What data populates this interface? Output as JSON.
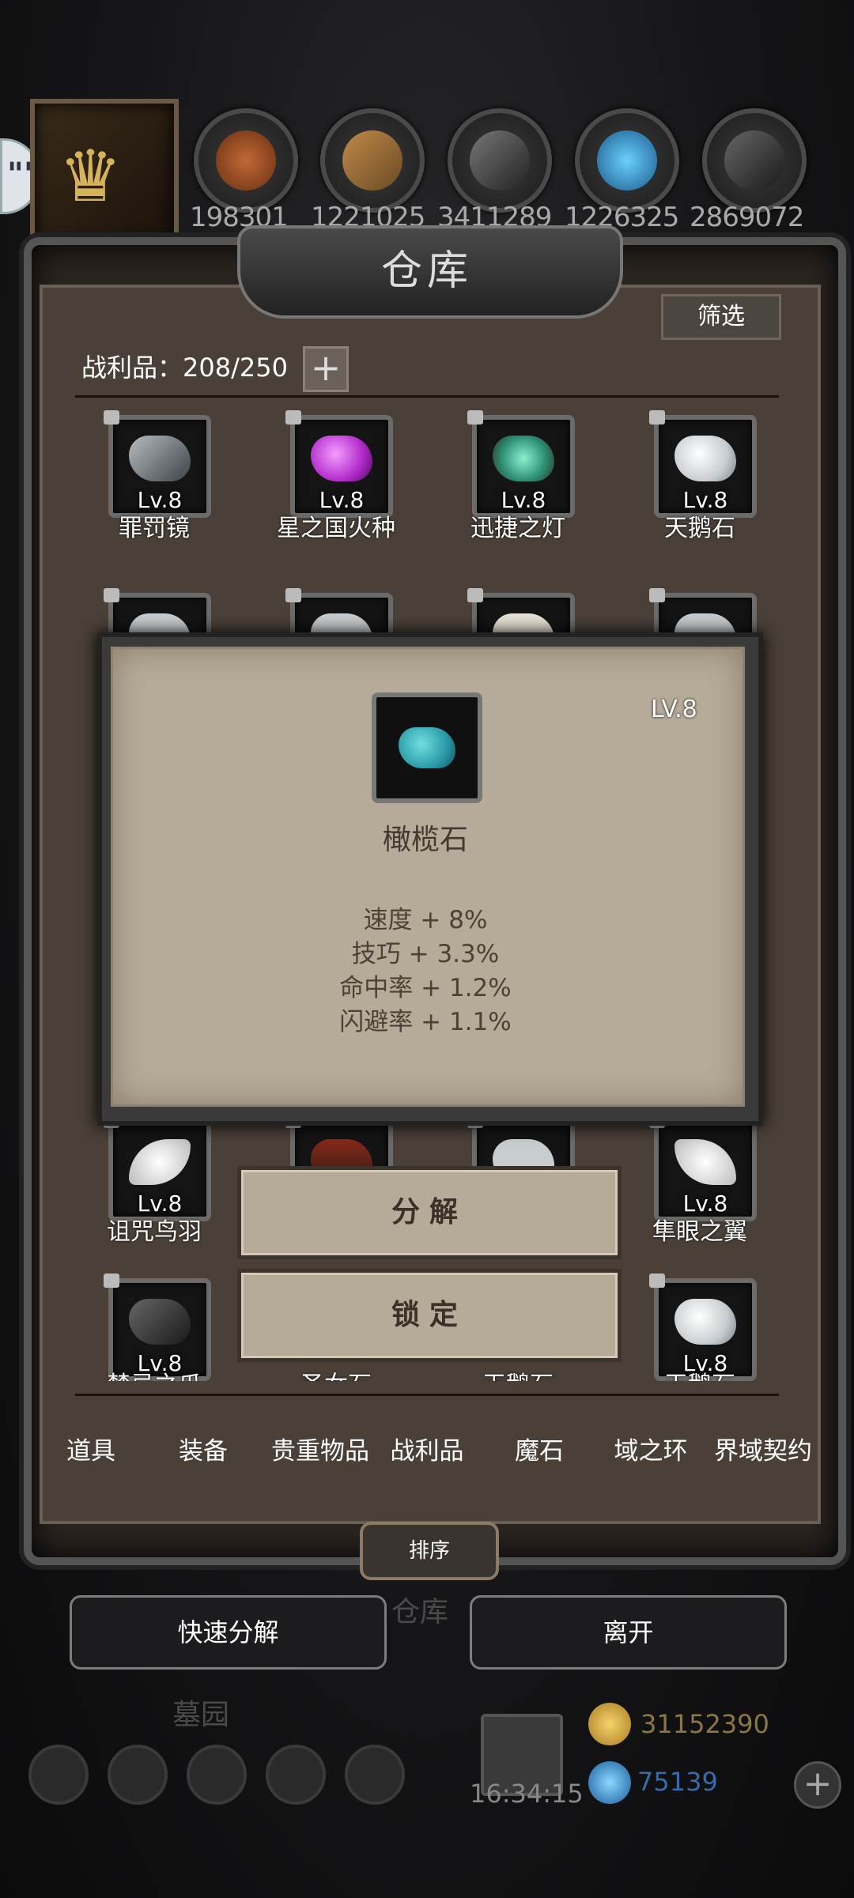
{
  "top": {
    "resources": [
      {
        "name": "wood-logs",
        "value": "198301",
        "color": "#b05a2a"
      },
      {
        "name": "planks",
        "value": "1221025",
        "color": "#a8743c"
      },
      {
        "name": "iron-ingots",
        "value": "3411289",
        "color": "#555555"
      },
      {
        "name": "crystals",
        "value": "1226325",
        "color": "#3aa0d8"
      },
      {
        "name": "steel-ingots",
        "value": "2869072",
        "color": "#4a4a4a"
      }
    ]
  },
  "warehouse": {
    "title": "仓库",
    "filter_label": "筛选",
    "loot_count": "战利品：208/250",
    "add_capacity": "+",
    "items_row1": [
      {
        "lv": "Lv.8",
        "name": "罪罚镜",
        "color": "#9aa2a8"
      },
      {
        "lv": "Lv.8",
        "name": "星之国火种",
        "color": "#c63ad6"
      },
      {
        "lv": "Lv.8",
        "name": "迅捷之灯",
        "color": "#5ad0b0"
      },
      {
        "lv": "Lv.8",
        "name": "天鹅石",
        "color": "#c8cdd0"
      }
    ],
    "items_row3": [
      {
        "lv": "Lv.8",
        "name": "诅咒鸟羽",
        "color": "#e6e6e6"
      },
      {
        "lv": "",
        "name": "",
        "color": "#6a4a3a"
      },
      {
        "lv": "",
        "name": "",
        "color": "#c8cdd0"
      },
      {
        "lv": "Lv.8",
        "name": "隼眼之翼",
        "color": "#e6e6e6"
      }
    ],
    "items_row4": [
      {
        "lv": "Lv.8",
        "name": "禁忌之爪",
        "color": "#555555"
      },
      {
        "lv": "",
        "name": "圣女石",
        "color": "#c8cdd0"
      },
      {
        "lv": "",
        "name": "天鹅石",
        "color": "#c8cdd0"
      },
      {
        "lv": "Lv.8",
        "name": "天鹅石",
        "color": "#c8cdd0"
      }
    ],
    "tabs": [
      "道具",
      "装备",
      "贵重物品",
      "战利品",
      "魔石",
      "域之环",
      "界域契约"
    ],
    "sort_label": "排序"
  },
  "bottom": {
    "quick_decompose": "快速分解",
    "leave": "离开",
    "bg_warehouse": "仓库",
    "bg_cemetery": "墓园",
    "time": "16:34:15",
    "gold": "31152390",
    "gems": "75139",
    "add": "+"
  },
  "popup": {
    "level": "LV.8",
    "item_name": "橄榄石",
    "stats": [
      "速度 + 8%",
      "技巧 + 3.3%",
      "命中率 + 1.2%",
      "闪避率 + 1.1%"
    ],
    "decompose": "分解",
    "lock": "锁定"
  }
}
